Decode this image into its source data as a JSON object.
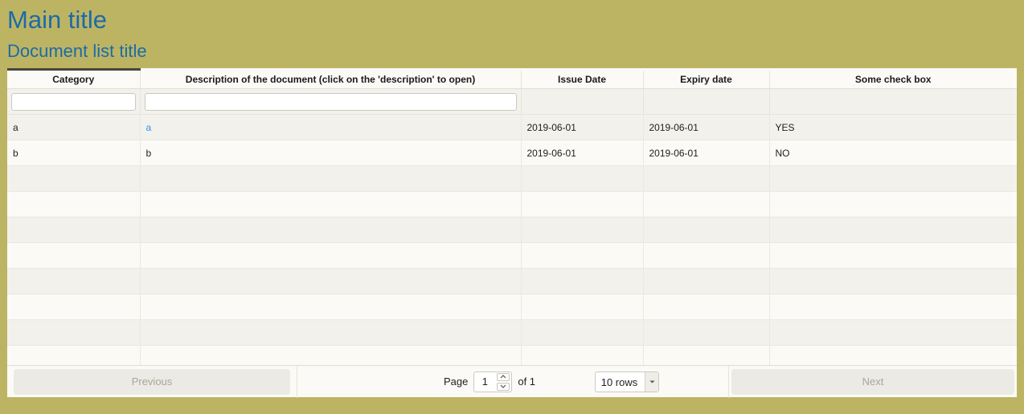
{
  "page": {
    "main_title": "Main title",
    "sub_title": "Document list title",
    "background_color": "#bdb463",
    "title_color": "#1c6ba8",
    "link_color": "#2f93e8"
  },
  "table": {
    "columns": [
      {
        "key": "category",
        "label": "Category",
        "sorted": true
      },
      {
        "key": "description",
        "label": "Description of the document (click on the 'description' to open)",
        "sorted": false
      },
      {
        "key": "issue_date",
        "label": "Issue Date",
        "sorted": false
      },
      {
        "key": "expiry_date",
        "label": "Expiry date",
        "sorted": false
      },
      {
        "key": "check_box",
        "label": "Some check box",
        "sorted": false
      }
    ],
    "filters": [
      {
        "name": "category-filter",
        "value": "",
        "placeholder": ""
      },
      {
        "name": "description-filter",
        "value": "",
        "placeholder": ""
      }
    ],
    "rows": [
      {
        "category": "a",
        "description": "a",
        "description_is_link": true,
        "issue_date": "2019-06-01",
        "expiry_date": "2019-06-01",
        "check_box": "YES"
      },
      {
        "category": "b",
        "description": "b",
        "description_is_link": false,
        "issue_date": "2019-06-01",
        "expiry_date": "2019-06-01",
        "check_box": "NO"
      }
    ],
    "empty_row_count": 8
  },
  "pager": {
    "previous_label": "Previous",
    "next_label": "Next",
    "page_label": "Page",
    "page_value": "1",
    "of_label": "of 1",
    "rows_per_page": "10 rows",
    "rows_options": [
      "10 rows"
    ],
    "previous_enabled": false,
    "next_enabled": false
  }
}
